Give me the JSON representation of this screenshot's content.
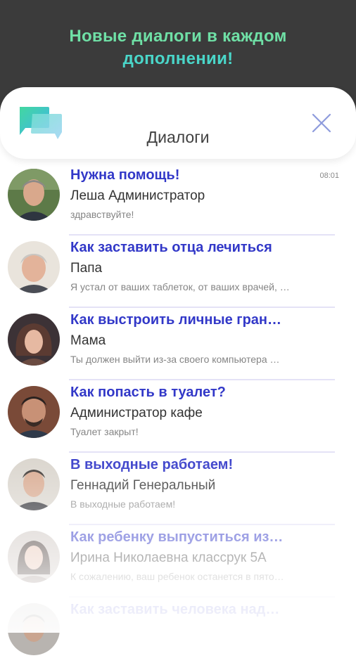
{
  "banner": {
    "line1": "Новые диалоги в каждом",
    "line2": "дополнении!",
    "color": "#5fe0b4"
  },
  "header": {
    "title": "Диалоги",
    "app_icon": "chat-bubbles-icon",
    "close_icon": "close-icon"
  },
  "dialogs": [
    {
      "title": "Нужна помощь!",
      "name": "Леша Администратор",
      "message": "здравствуйте!",
      "time": "08:01"
    },
    {
      "title": "Как заставить отца лечиться",
      "name": "Папа",
      "message": "Я устал от ваших таблеток, от ваших врачей, …",
      "time": ""
    },
    {
      "title": "Как выстроить личные гран…",
      "name": "Мама",
      "message": "Ты должен выйти из-за своего компьютера …",
      "time": ""
    },
    {
      "title": "Как попасть в туалет?",
      "name": "Администратор кафе",
      "message": "Туалет закрыт!",
      "time": ""
    },
    {
      "title": "В выходные работаем!",
      "name": "Геннадий Генеральный",
      "message": "В выходные работаем!",
      "time": ""
    },
    {
      "title": "Как ребенку выпуститься из…",
      "name": "Ирина Николаевна классрук 5А",
      "message": "К сожалению, ваш ребенок останется в пято…",
      "time": ""
    },
    {
      "title": "Как заставить человека над…",
      "name": "",
      "message": "",
      "time": ""
    }
  ],
  "colors": {
    "accent": "#3238c8",
    "banner_bg": "#3b3b3b"
  }
}
